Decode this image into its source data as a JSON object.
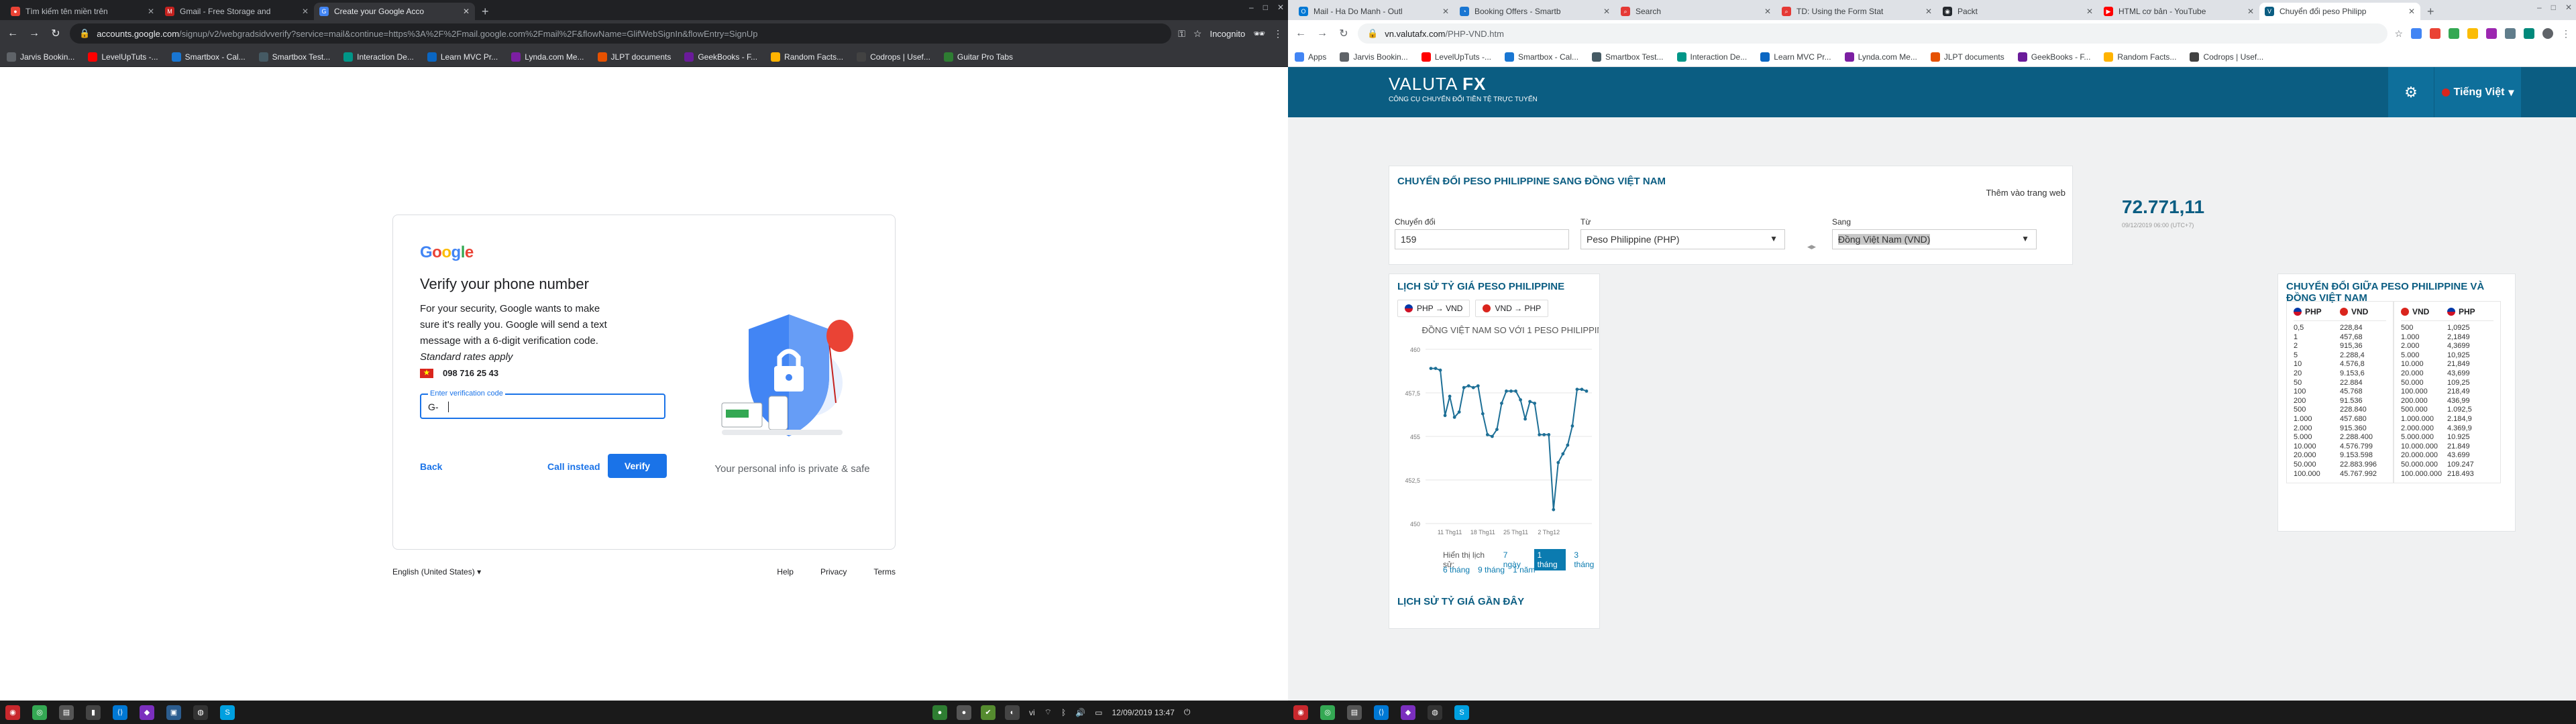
{
  "left": {
    "tabs": [
      {
        "label": "Tìm kiếm tên miền trên",
        "active": false
      },
      {
        "label": "Gmail - Free Storage and",
        "active": false
      },
      {
        "label": "Create your Google Acco",
        "active": true
      }
    ],
    "url_host": "accounts.google.com",
    "url_path": "/signup/v2/webgradsidvverify?service=mail&continue=https%3A%2F%2Fmail.google.com%2Fmail%2F&flowName=GlifWebSignIn&flowEntry=SignUp",
    "incognito": "Incognito",
    "bookmarks": [
      "Jarvis Bookin...",
      "LevelUpTuts -...",
      "Smartbox - Cal...",
      "Smartbox Test...",
      "Interaction De...",
      "Learn MVC Pr...",
      "Lynda.com Me...",
      "JLPT documents",
      "GeekBooks - F...",
      "Random Facts...",
      "Codrops | Usef...",
      "Guitar Pro Tabs"
    ],
    "page": {
      "logo": "Google",
      "title": "Verify your phone number",
      "desc": "For your security, Google wants to make sure it's really you. Google will send a text message with a 6-digit verification code.",
      "desc_em": "Standard rates apply",
      "phone": "098 716 25 43",
      "field_label": "Enter verification code",
      "field_value": "G-",
      "back": "Back",
      "call": "Call instead",
      "verify": "Verify",
      "private": "Your personal info is private & safe",
      "footer_lang": "English (United States)",
      "footer_links": [
        "Help",
        "Privacy",
        "Terms"
      ]
    }
  },
  "right": {
    "tabs": [
      {
        "label": "Mail - Ha Do Manh - Outl",
        "active": false
      },
      {
        "label": "Booking Offers - Smartb",
        "active": false
      },
      {
        "label": "Search",
        "active": false
      },
      {
        "label": "TD: Using the Form Stat",
        "active": false
      },
      {
        "label": "Packt",
        "active": false
      },
      {
        "label": "HTML cơ bản - YouTube",
        "active": false
      },
      {
        "label": "Chuyển đổi peso Philipp",
        "active": true
      }
    ],
    "url_host": "vn.valutafx.com",
    "url_path": "/PHP-VND.htm",
    "bookmarks": [
      "Apps",
      "Jarvis Bookin...",
      "LevelUpTuts -...",
      "Smartbox - Cal...",
      "Smartbox Test...",
      "Interaction De...",
      "Learn MVC Pr...",
      "Lynda.com Me...",
      "JLPT documents",
      "GeekBooks - F...",
      "Random Facts...",
      "Codrops | Usef..."
    ],
    "page": {
      "brand": "VALUTA",
      "brand_fx": "FX",
      "tagline": "CÔNG CỤ CHUYỂN ĐỔI TIỀN TỆ TRỰC TUYẾN",
      "language": "Tiếng Việt",
      "converter_title": "CHUYỂN ĐỔI PESO PHILIPPINE SANG ĐỒNG VIỆT NAM",
      "add_to_web": "Thêm vào trang web",
      "amount_label": "Chuyển đổi",
      "amount": "159",
      "from_label": "Từ",
      "from": "Peso Philippine (PHP)",
      "to_label": "Sang",
      "to": "Đồng Việt Nam (VND)",
      "result": "72.771,11",
      "result_time": "09/12/2019 06:00 (UTC+7)",
      "history_title": "LỊCH SỬ TỶ GIÁ PESO PHILIPPINE",
      "pill1": "PHP → VND",
      "pill2": "VND → PHP",
      "range_label": "Hiển thị lịch sử:",
      "ranges": [
        "7 ngày",
        "1 tháng",
        "3 tháng",
        "6 tháng",
        "9 tháng",
        "1 năm"
      ],
      "active_range": "1 tháng",
      "recent_title": "LỊCH SỬ TỶ GIÁ GẦN ĐÂY",
      "table_title": "CHUYỂN ĐỔI GIỮA PESO PHILIPPINE VÀ ĐỒNG VIỆT NAM",
      "table_left": {
        "headers": [
          "PHP",
          "VND"
        ],
        "rows": [
          [
            "0,5",
            "228,84"
          ],
          [
            "1",
            "457,68"
          ],
          [
            "2",
            "915,36"
          ],
          [
            "5",
            "2.288,4"
          ],
          [
            "10",
            "4.576,8"
          ],
          [
            "20",
            "9.153,6"
          ],
          [
            "50",
            "22.884"
          ],
          [
            "100",
            "45.768"
          ],
          [
            "200",
            "91.536"
          ],
          [
            "500",
            "228.840"
          ],
          [
            "1.000",
            "457.680"
          ],
          [
            "2.000",
            "915.360"
          ],
          [
            "5.000",
            "2.288.400"
          ],
          [
            "10.000",
            "4.576.799"
          ],
          [
            "20.000",
            "9.153.598"
          ],
          [
            "50.000",
            "22.883.996"
          ],
          [
            "100.000",
            "45.767.992"
          ]
        ]
      },
      "table_right": {
        "headers": [
          "VND",
          "PHP"
        ],
        "rows": [
          [
            "500",
            "1,0925"
          ],
          [
            "1.000",
            "2,1849"
          ],
          [
            "2.000",
            "4,3699"
          ],
          [
            "5.000",
            "10,925"
          ],
          [
            "10.000",
            "21,849"
          ],
          [
            "20.000",
            "43,699"
          ],
          [
            "50.000",
            "109,25"
          ],
          [
            "100.000",
            "218,49"
          ],
          [
            "200.000",
            "436,99"
          ],
          [
            "500.000",
            "1.092,5"
          ],
          [
            "1.000.000",
            "2.184,9"
          ],
          [
            "2.000.000",
            "4.369,9"
          ],
          [
            "5.000.000",
            "10.925"
          ],
          [
            "10.000.000",
            "21.849"
          ],
          [
            "20.000.000",
            "43.699"
          ],
          [
            "50.000.000",
            "109.247"
          ],
          [
            "100.000.000",
            "218.493"
          ]
        ]
      }
    }
  },
  "taskbar": {
    "lang": "vi",
    "clock": "12/09/2019 13:47"
  },
  "chart_data": {
    "type": "line",
    "title": "ĐỒNG VIỆT NAM SO VỚI 1 PESO PHILIPPINE",
    "xlabel": "",
    "ylabel": "",
    "x_ticks": [
      "11 Thg11",
      "18 Thg11",
      "25 Thg11",
      "2 Thg12"
    ],
    "y_ticks": [
      "460",
      "457,5",
      "455",
      "452,5",
      "450"
    ],
    "ylim": [
      450,
      460
    ],
    "series": [
      {
        "values": [
          458.9,
          458.9,
          458.8,
          456.2,
          457.3,
          456.1,
          456.4,
          457.8,
          457.9,
          457.8,
          457.9,
          456.3,
          455.1,
          455.0,
          455.4,
          456.9,
          457.6,
          457.6,
          457.6,
          457.1,
          456.0,
          457.0,
          456.9,
          455.1,
          455.1,
          455.1,
          450.8,
          453.5,
          454.0,
          454.5,
          455.6,
          457.7,
          457.7,
          457.6
        ],
        "color": "#1d6f96"
      }
    ],
    "grid": true
  }
}
